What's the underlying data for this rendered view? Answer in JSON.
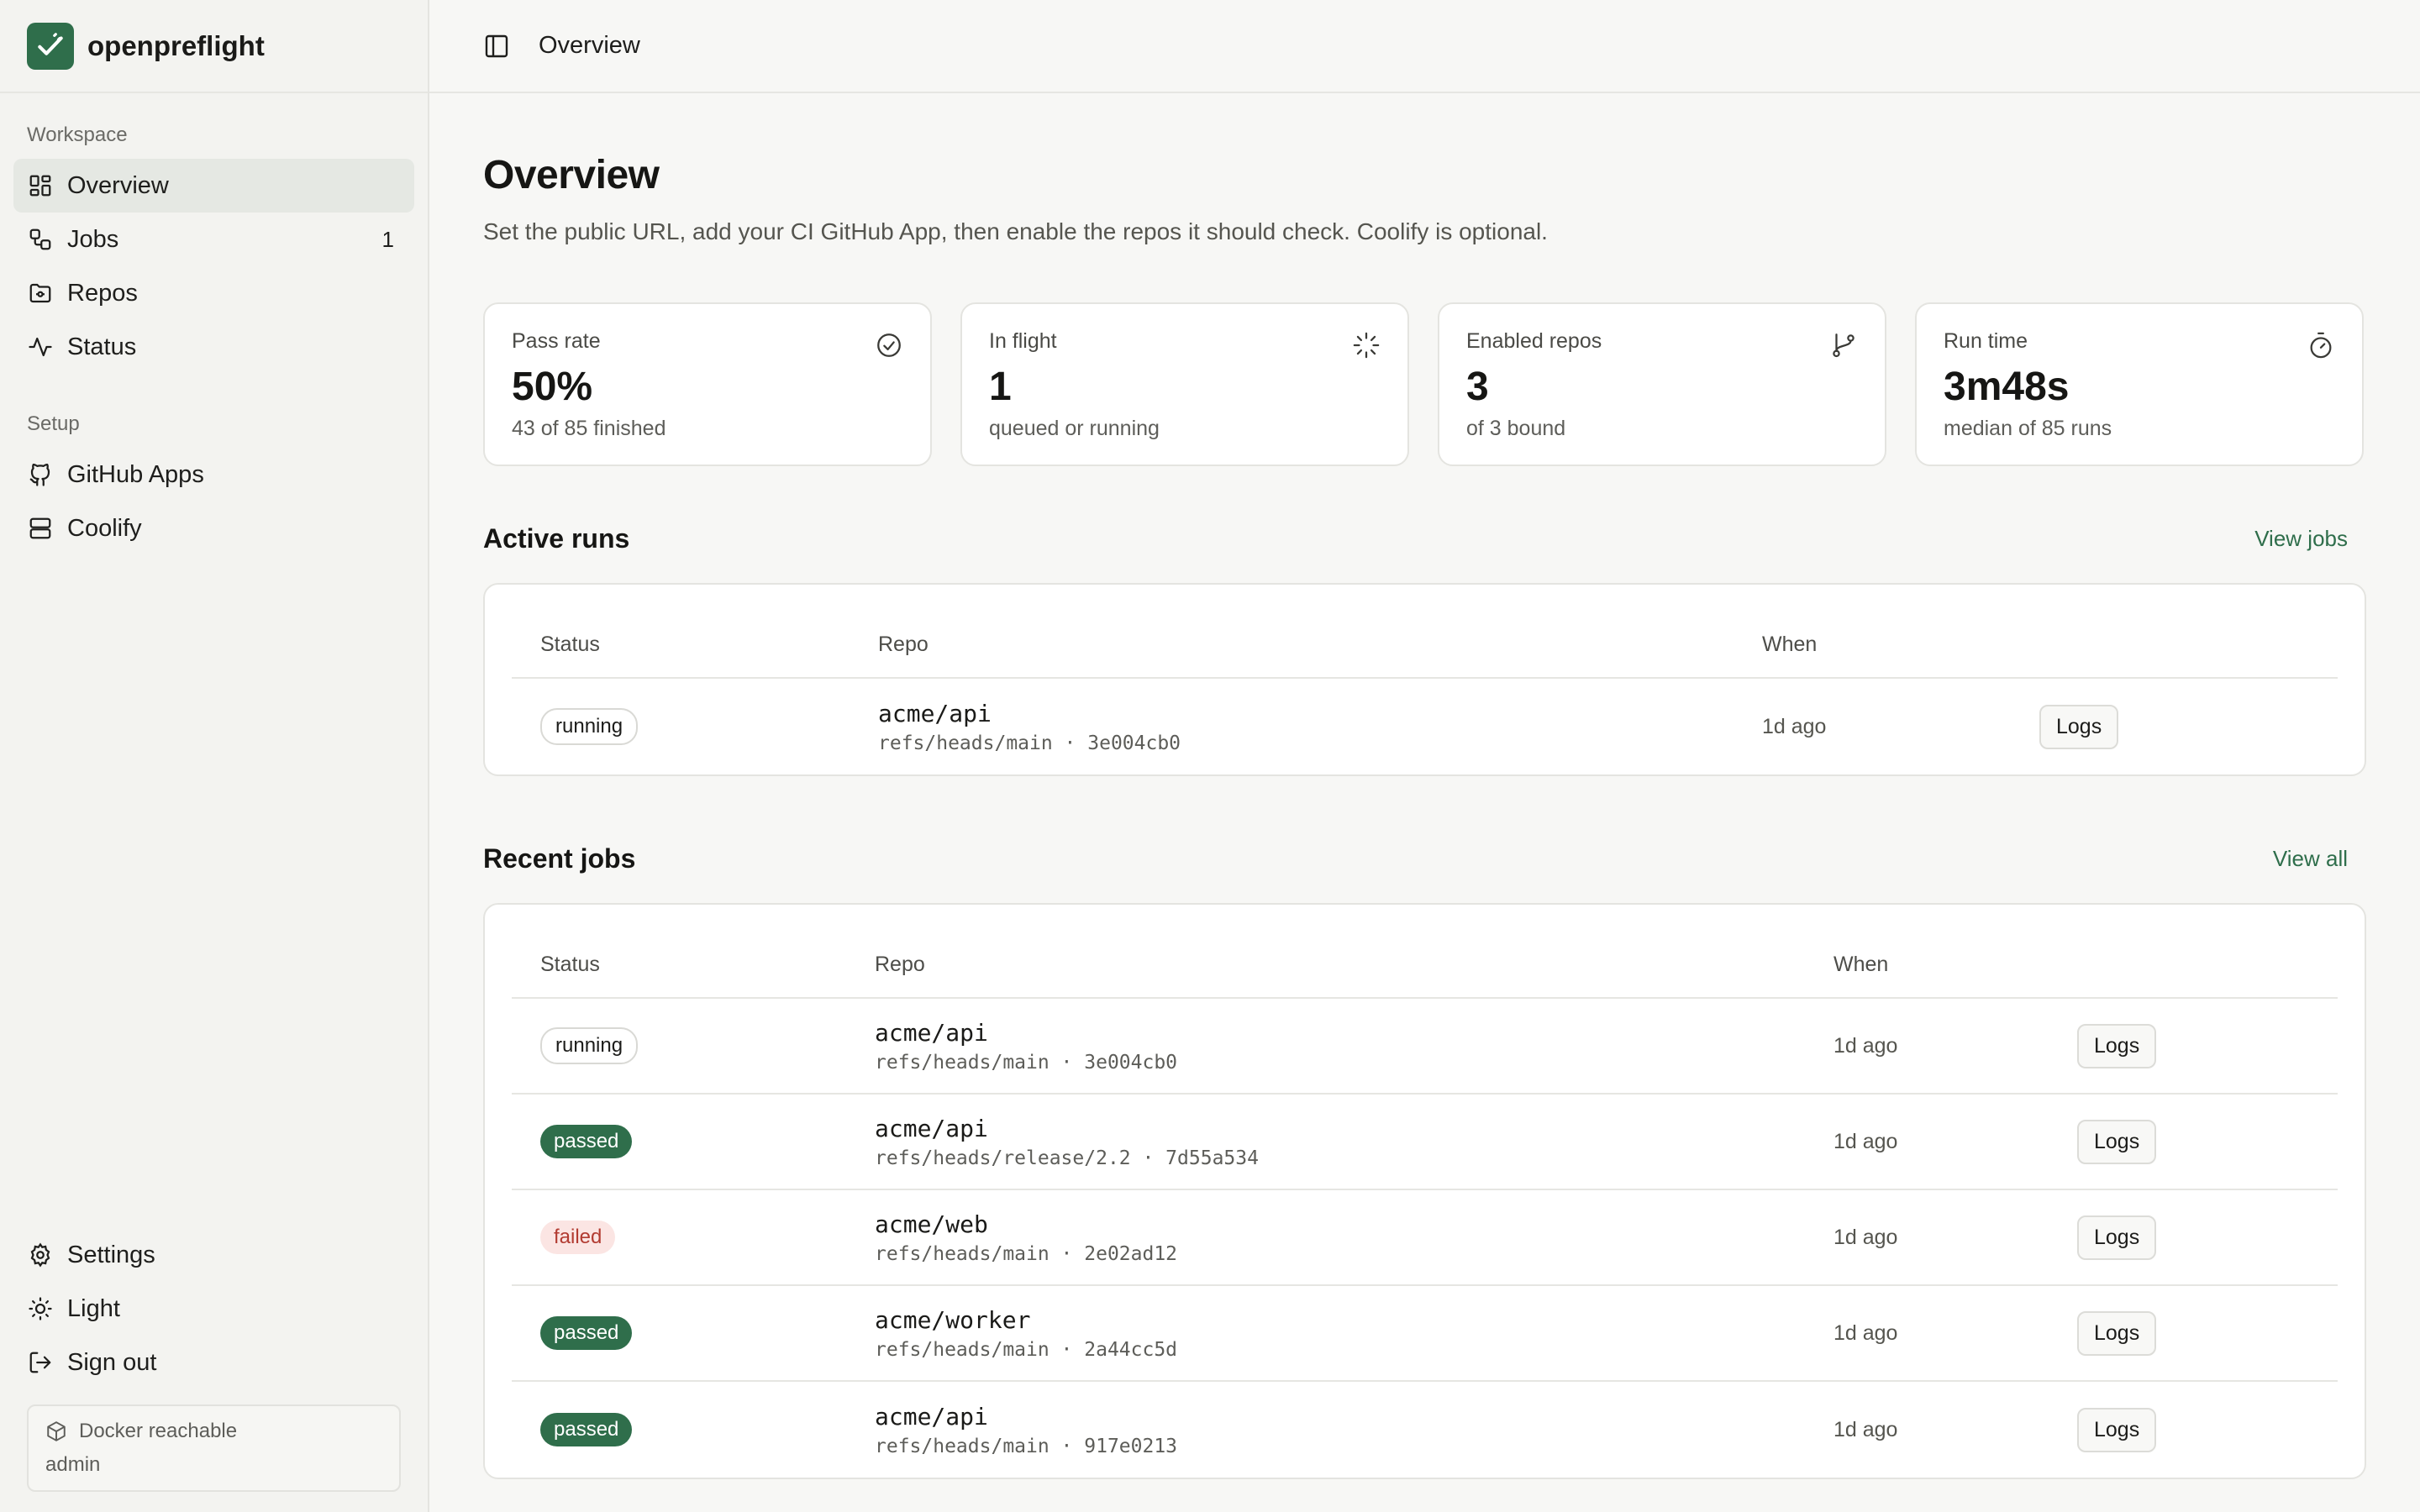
{
  "brand": {
    "name": "openpreflight"
  },
  "sidebar": {
    "workspace_heading": "Workspace",
    "items": [
      {
        "label": "Overview",
        "icon": "dashboard-icon",
        "active": true
      },
      {
        "label": "Jobs",
        "icon": "workflow-icon",
        "count": "1"
      },
      {
        "label": "Repos",
        "icon": "folder-git-icon"
      },
      {
        "label": "Status",
        "icon": "activity-icon"
      }
    ],
    "setup_heading": "Setup",
    "setup_items": [
      {
        "label": "GitHub Apps",
        "icon": "github-icon"
      },
      {
        "label": "Coolify",
        "icon": "server-icon"
      }
    ],
    "bottom_items": [
      {
        "label": "Settings",
        "icon": "gear-icon"
      },
      {
        "label": "Light",
        "icon": "sun-icon"
      },
      {
        "label": "Sign out",
        "icon": "logout-icon"
      }
    ],
    "env": {
      "status": "Docker reachable",
      "user": "admin"
    }
  },
  "topbar": {
    "breadcrumb": "Overview"
  },
  "page": {
    "title": "Overview",
    "subtitle": "Set the public URL, add your CI GitHub App, then enable the repos it should check. Coolify is optional."
  },
  "stats": [
    {
      "label": "Pass rate",
      "value": "50%",
      "hint": "43 of 85 finished",
      "icon": "check-circle-icon"
    },
    {
      "label": "In flight",
      "value": "1",
      "hint": "queued or running",
      "icon": "loader-icon"
    },
    {
      "label": "Enabled repos",
      "value": "3",
      "hint": "of 3 bound",
      "icon": "git-branch-icon"
    },
    {
      "label": "Run time",
      "value": "3m48s",
      "hint": "median of 85 runs",
      "icon": "timer-icon"
    }
  ],
  "active_runs": {
    "title": "Active runs",
    "link": "View jobs",
    "columns": {
      "status": "Status",
      "repo": "Repo",
      "when": "When"
    },
    "rows": [
      {
        "status": "running",
        "repo": "acme/api",
        "ref": "refs/heads/main · 3e004cb0",
        "when": "1d ago",
        "action": "Logs"
      }
    ]
  },
  "recent_jobs": {
    "title": "Recent jobs",
    "link": "View all",
    "columns": {
      "status": "Status",
      "repo": "Repo",
      "when": "When"
    },
    "rows": [
      {
        "status": "running",
        "repo": "acme/api",
        "ref": "refs/heads/main · 3e004cb0",
        "when": "1d ago",
        "action": "Logs"
      },
      {
        "status": "passed",
        "repo": "acme/api",
        "ref": "refs/heads/release/2.2 · 7d55a534",
        "when": "1d ago",
        "action": "Logs"
      },
      {
        "status": "failed",
        "repo": "acme/web",
        "ref": "refs/heads/main · 2e02ad12",
        "when": "1d ago",
        "action": "Logs"
      },
      {
        "status": "passed",
        "repo": "acme/worker",
        "ref": "refs/heads/main · 2a44cc5d",
        "when": "1d ago",
        "action": "Logs"
      },
      {
        "status": "passed",
        "repo": "acme/api",
        "ref": "refs/heads/main · 917e0213",
        "when": "1d ago",
        "action": "Logs"
      }
    ]
  },
  "colors": {
    "accent": "#2f6e4b",
    "failed_text": "#b23b31",
    "failed_bg": "#fbe5e3"
  }
}
